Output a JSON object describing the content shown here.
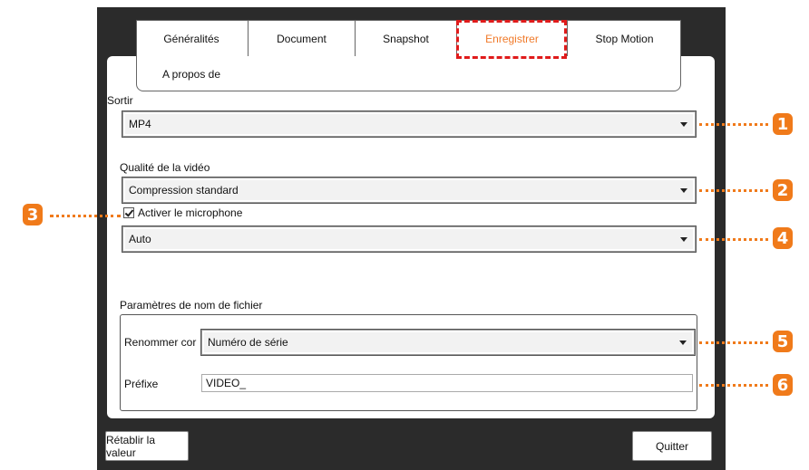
{
  "tabs": [
    {
      "label": "Généralités",
      "active": false
    },
    {
      "label": "Document",
      "active": false
    },
    {
      "label": "Snapshot",
      "active": false
    },
    {
      "label": "Enregistrer",
      "active": true
    },
    {
      "label": "Stop Motion",
      "active": false
    },
    {
      "label": "A propos de",
      "active": false
    }
  ],
  "output": {
    "label": "Sortir",
    "value": "MP4"
  },
  "quality": {
    "label": "Qualité de la vidéo",
    "value": "Compression standard"
  },
  "microphone": {
    "checkbox_label": "Activer le microphone",
    "checked": true,
    "device": "Auto"
  },
  "filename": {
    "group_label": "Paramètres de nom de fichier",
    "rename_label": "Renommer cor",
    "rename_value": "Numéro de série",
    "prefix_label": "Préfixe",
    "prefix_value": "VIDEO_"
  },
  "buttons": {
    "reset": "Rétablir la valeur",
    "quit": "Quitter"
  },
  "callouts": [
    "1",
    "2",
    "3",
    "4",
    "5",
    "6"
  ],
  "colors": {
    "accent": "#f07a1a",
    "highlight": "#e01b1b",
    "window_bg": "#2b2b2b"
  }
}
